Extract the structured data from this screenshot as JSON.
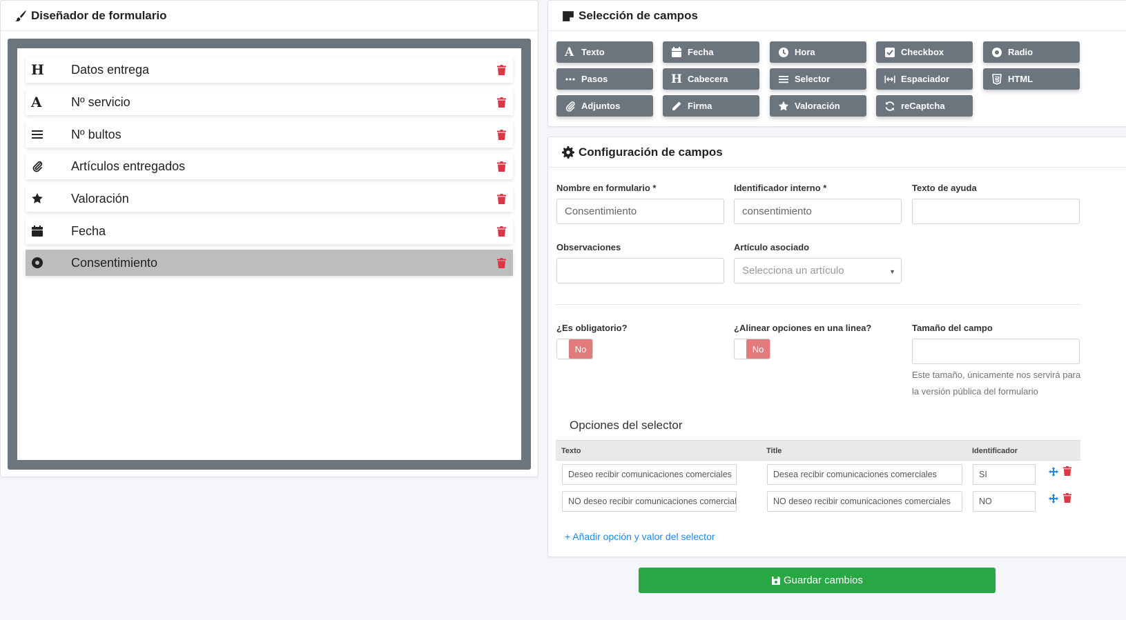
{
  "designer": {
    "title": "Diseñador de formulario",
    "items": [
      {
        "icon": "heading-icon",
        "label": "Datos entrega"
      },
      {
        "icon": "text-icon",
        "label": "Nº servicio"
      },
      {
        "icon": "list-icon",
        "label": "Nº bultos"
      },
      {
        "icon": "paperclip-icon",
        "label": "Artículos entregados"
      },
      {
        "icon": "star-icon",
        "label": "Valoración"
      },
      {
        "icon": "calendar-icon",
        "label": "Fecha"
      },
      {
        "icon": "radio-icon",
        "label": "Consentimiento"
      }
    ]
  },
  "selection": {
    "title": "Selección de campos",
    "buttons": [
      {
        "icon": "text-icon",
        "label": "Texto"
      },
      {
        "icon": "calendar-icon",
        "label": "Fecha"
      },
      {
        "icon": "clock-icon",
        "label": "Hora"
      },
      {
        "icon": "checkbox-icon",
        "label": "Checkbox"
      },
      {
        "icon": "radio-icon",
        "label": "Radio"
      },
      {
        "icon": "dots-icon",
        "label": "Pasos"
      },
      {
        "icon": "heading-icon",
        "label": "Cabecera"
      },
      {
        "icon": "list-icon",
        "label": "Selector"
      },
      {
        "icon": "spacer-icon",
        "label": "Espaciador"
      },
      {
        "icon": "html5-icon",
        "label": "HTML"
      },
      {
        "icon": "paperclip-icon",
        "label": "Adjuntos"
      },
      {
        "icon": "pencil-icon",
        "label": "Firma"
      },
      {
        "icon": "star-icon",
        "label": "Valoración"
      },
      {
        "icon": "sync-icon",
        "label": "reCaptcha"
      }
    ]
  },
  "config": {
    "title": "Configuración de campos",
    "name_label": "Nombre en formulario *",
    "name_value": "Consentimiento",
    "id_label": "Identificador interno *",
    "id_value": "consentimiento",
    "help_label": "Texto de ayuda",
    "help_value": "",
    "obs_label": "Observaciones",
    "obs_value": "",
    "article_label": "Artículo asociado",
    "article_placeholder": "Selecciona un artículo",
    "required_label": "¿Es obligatorio?",
    "required_value": "No",
    "inline_label": "¿Alinear opciones en una linea?",
    "inline_value": "No",
    "size_label": "Tamaño del campo",
    "size_value": "",
    "size_help": "Este tamaño, únicamente nos servirá para la versión pública del formulario",
    "options_title": "Opciones del selector",
    "options_headers": {
      "text": "Texto",
      "title": "Title",
      "id": "Identificador"
    },
    "options": [
      {
        "text": "Deseo recibir comunicaciones comerciales",
        "title": "Desea recibir comunicaciones comerciales",
        "id": "SI"
      },
      {
        "text": "NO deseo recibir comunicaciones comerciales",
        "title": "NO deseo recibir comunicaciones comerciales",
        "id": "NO"
      }
    ],
    "add_option": "+ Añadir opción y valor del selector"
  },
  "save_label": "Guardar cambios",
  "colors": {
    "primary_btn": "#6c757d",
    "save": "#28a745",
    "danger": "#dc3545",
    "toggle_no": "#e27c7c",
    "link": "#1e88e5"
  }
}
